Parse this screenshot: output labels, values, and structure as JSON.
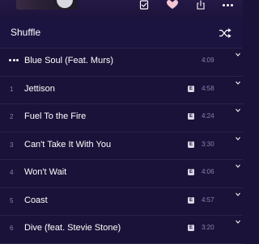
{
  "header": {
    "icons": [
      "checkmark-icon",
      "heart-icon",
      "share-icon",
      "more-icon"
    ],
    "heart_color": "#f4c6d4"
  },
  "shuffle": {
    "label": "Shuffle",
    "icon": "shuffle-icon"
  },
  "tracks": [
    {
      "number": "",
      "now_playing": true,
      "title": "Blue Soul (Feat. Murs)",
      "explicit": false,
      "duration": "4:09"
    },
    {
      "number": "1",
      "now_playing": false,
      "title": "Jettison",
      "explicit": true,
      "duration": "4:58"
    },
    {
      "number": "2",
      "now_playing": false,
      "title": "Fuel To the Fire",
      "explicit": true,
      "duration": "4:24"
    },
    {
      "number": "3",
      "now_playing": false,
      "title": "Can't Take It With You",
      "explicit": true,
      "duration": "3:30"
    },
    {
      "number": "4",
      "now_playing": false,
      "title": "Won't Wait",
      "explicit": true,
      "duration": "4:06"
    },
    {
      "number": "5",
      "now_playing": false,
      "title": "Coast",
      "explicit": true,
      "duration": "4:57"
    },
    {
      "number": "6",
      "now_playing": false,
      "title": "Dive (feat. Stevie Stone)",
      "explicit": true,
      "duration": "3:20"
    }
  ],
  "explicit_label": "E",
  "colors": {
    "background": "#1a1238",
    "divider": "#2b2350",
    "secondary_text": "#8a83a8"
  }
}
